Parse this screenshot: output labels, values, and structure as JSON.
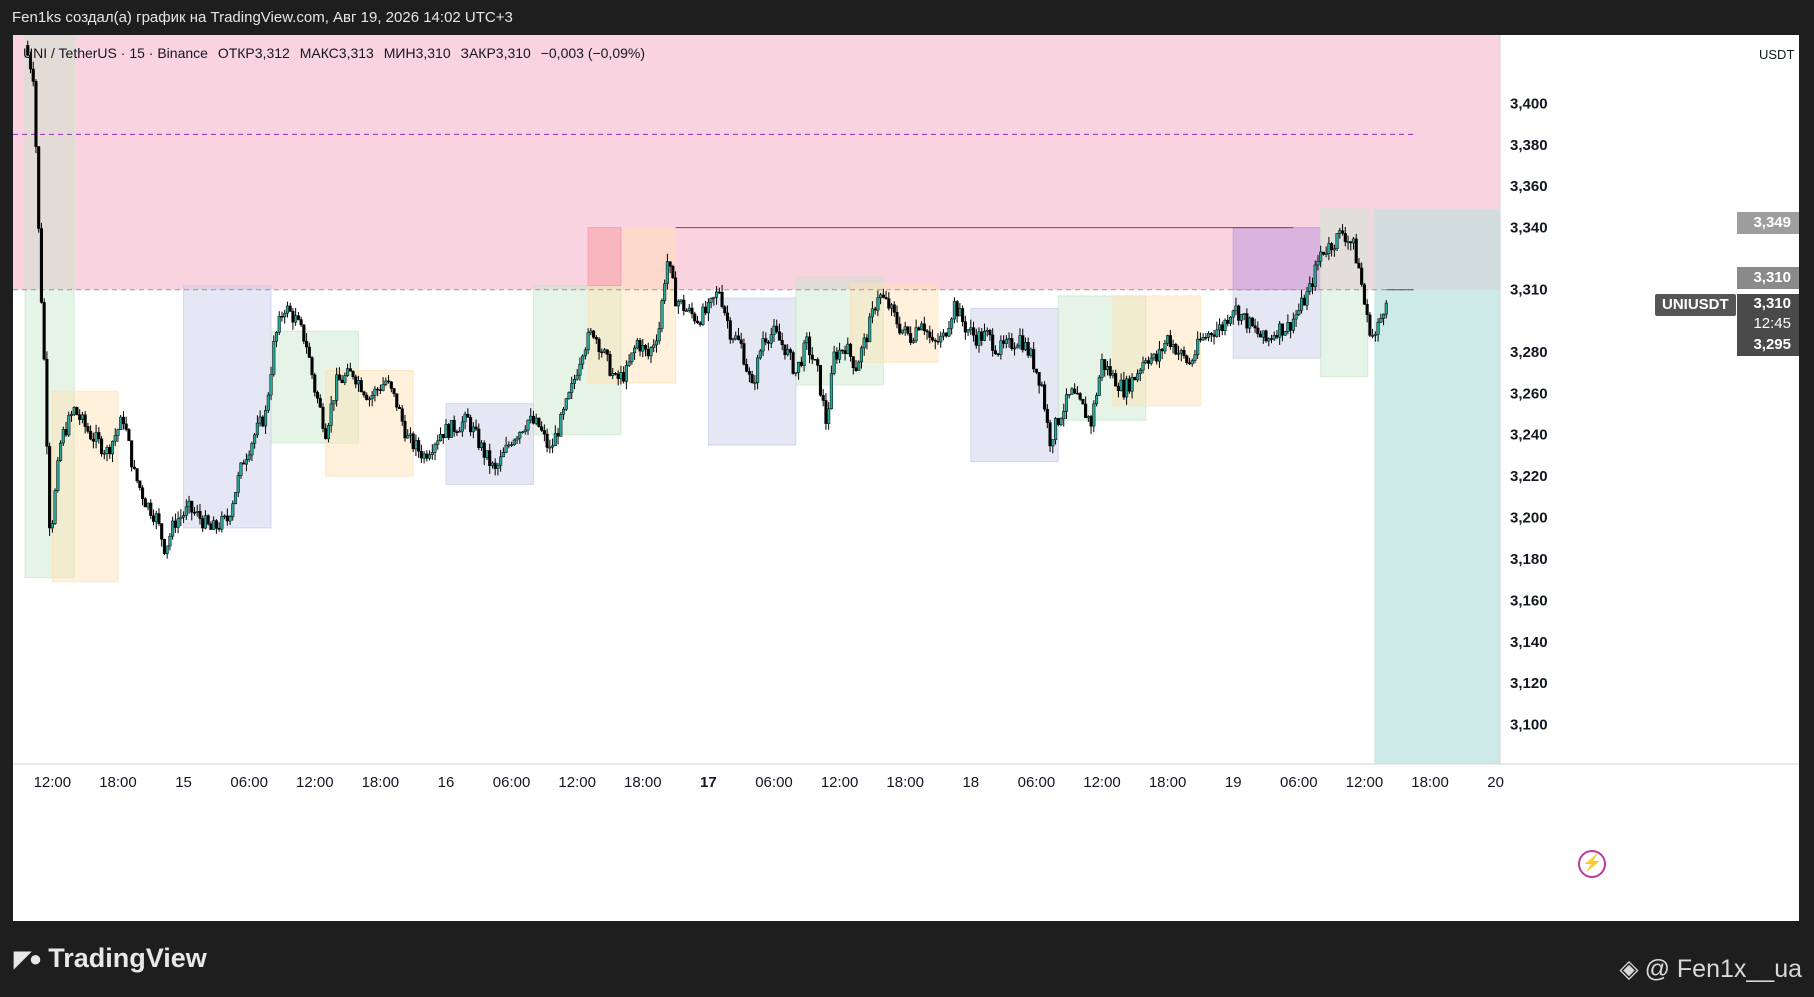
{
  "caption": "Fen1ks создал(а) график на TradingView.com, Авг 19, 2026 14:02 UTC+3",
  "ohlc": {
    "symbol": "UNI / TetherUS · 15 · Binance",
    "open": "ОТКР3,312",
    "high": "МАКС3,313",
    "low": "МИН3,310",
    "close": "ЗАКР3,310",
    "change": "−0,003 (−0,09%)"
  },
  "unit": "USDT",
  "badges": {
    "level_high": "3,349",
    "level_mid": "3,310",
    "current": "3,310",
    "countdown": "12:45",
    "level_low": "3,295",
    "symbol": "UNIUSDT"
  },
  "brand": "TradingView",
  "watermark": "@ Fen1x__ua",
  "colors": {
    "up": "#26a69a",
    "down": "#000000",
    "supply_zone": "#f8bbd0",
    "target_zone": "#b2dfdb",
    "blue_box": "#c5cae9",
    "green_box": "#c8e6c9",
    "orange_box": "#ffe0b2"
  },
  "icons": [
    "tradingview-logo-icon",
    "flash-icon",
    "binance-icon"
  ],
  "chart_data": {
    "type": "candlestick",
    "title": "",
    "y_ticks": [
      "3,400",
      "3,380",
      "3,360",
      "3,340",
      "3,310",
      "3,280",
      "3,260",
      "3,240",
      "3,220",
      "3,200",
      "3,180",
      "3,160",
      "3,140",
      "3,120",
      "3,100"
    ],
    "y_tick_values": [
      3.4,
      3.38,
      3.36,
      3.34,
      3.31,
      3.28,
      3.26,
      3.24,
      3.22,
      3.2,
      3.18,
      3.16,
      3.14,
      3.12,
      3.1
    ],
    "ylim": [
      3.081,
      3.433
    ],
    "x_ticks": [
      "12:00",
      "18:00",
      "15",
      "06:00",
      "12:00",
      "18:00",
      "16",
      "06:00",
      "12:00",
      "18:00",
      "17",
      "06:00",
      "12:00",
      "18:00",
      "18",
      "06:00",
      "12:00",
      "18:00",
      "19",
      "06:00",
      "12:00",
      "18:00",
      "20"
    ],
    "x_tick_hours": [
      12,
      18,
      24,
      30,
      36,
      42,
      48,
      54,
      60,
      66,
      72,
      78,
      84,
      90,
      96,
      102,
      108,
      114,
      120,
      126,
      132,
      138,
      144
    ],
    "bold_x_ticks": [
      "17"
    ],
    "xlim": [
      8.4,
      144.4
    ],
    "close_path": [
      [
        9.5,
        3.428
      ],
      [
        10.3,
        3.413
      ],
      [
        10.8,
        3.33
      ],
      [
        11.3,
        3.27
      ],
      [
        11.8,
        3.19
      ],
      [
        12.8,
        3.238
      ],
      [
        14,
        3.252
      ],
      [
        15.5,
        3.24
      ],
      [
        17,
        3.232
      ],
      [
        18.5,
        3.248
      ],
      [
        19.5,
        3.221
      ],
      [
        20.5,
        3.208
      ],
      [
        21.5,
        3.2
      ],
      [
        22.3,
        3.185
      ],
      [
        23.2,
        3.198
      ],
      [
        24.5,
        3.204
      ],
      [
        25.5,
        3.2
      ],
      [
        26.5,
        3.194
      ],
      [
        28,
        3.199
      ],
      [
        29.5,
        3.228
      ],
      [
        30.5,
        3.24
      ],
      [
        31.5,
        3.25
      ],
      [
        32.3,
        3.285
      ],
      [
        33.2,
        3.302
      ],
      [
        34.2,
        3.296
      ],
      [
        35.2,
        3.285
      ],
      [
        36,
        3.262
      ],
      [
        37,
        3.242
      ],
      [
        38,
        3.265
      ],
      [
        39.5,
        3.27
      ],
      [
        41,
        3.258
      ],
      [
        42.5,
        3.266
      ],
      [
        43.5,
        3.255
      ],
      [
        44.5,
        3.238
      ],
      [
        46,
        3.23
      ],
      [
        47.5,
        3.241
      ],
      [
        48.5,
        3.243
      ],
      [
        50,
        3.247
      ],
      [
        51.5,
        3.231
      ],
      [
        52.5,
        3.222
      ],
      [
        54,
        3.238
      ],
      [
        55.5,
        3.247
      ],
      [
        56.5,
        3.244
      ],
      [
        57.5,
        3.232
      ],
      [
        58.5,
        3.246
      ],
      [
        59.5,
        3.262
      ],
      [
        60.5,
        3.282
      ],
      [
        61.5,
        3.29
      ],
      [
        62.5,
        3.278
      ],
      [
        63.5,
        3.266
      ],
      [
        64.5,
        3.27
      ],
      [
        65.5,
        3.285
      ],
      [
        66.5,
        3.278
      ],
      [
        67.5,
        3.292
      ],
      [
        68.2,
        3.325
      ],
      [
        69,
        3.306
      ],
      [
        70,
        3.3
      ],
      [
        71,
        3.296
      ],
      [
        72,
        3.3
      ],
      [
        73,
        3.31
      ],
      [
        74,
        3.29
      ],
      [
        75,
        3.283
      ],
      [
        76,
        3.262
      ],
      [
        77,
        3.287
      ],
      [
        78,
        3.289
      ],
      [
        79,
        3.282
      ],
      [
        80,
        3.27
      ],
      [
        81,
        3.284
      ],
      [
        82,
        3.27
      ],
      [
        82.8,
        3.245
      ],
      [
        83.5,
        3.278
      ],
      [
        84.5,
        3.283
      ],
      [
        85.5,
        3.273
      ],
      [
        86.5,
        3.288
      ],
      [
        87.5,
        3.308
      ],
      [
        88.5,
        3.302
      ],
      [
        89.5,
        3.292
      ],
      [
        90.5,
        3.287
      ],
      [
        91.5,
        3.296
      ],
      [
        92.5,
        3.283
      ],
      [
        93.5,
        3.287
      ],
      [
        94.5,
        3.303
      ],
      [
        95.5,
        3.292
      ],
      [
        96.5,
        3.287
      ],
      [
        97.5,
        3.288
      ],
      [
        98.5,
        3.281
      ],
      [
        99.5,
        3.283
      ],
      [
        100.5,
        3.287
      ],
      [
        101.5,
        3.278
      ],
      [
        102.5,
        3.264
      ],
      [
        103.2,
        3.237
      ],
      [
        104.2,
        3.25
      ],
      [
        105.2,
        3.26
      ],
      [
        106.2,
        3.253
      ],
      [
        107,
        3.246
      ],
      [
        108,
        3.275
      ],
      [
        109,
        3.268
      ],
      [
        110,
        3.262
      ],
      [
        111,
        3.268
      ],
      [
        112,
        3.278
      ],
      [
        113,
        3.276
      ],
      [
        114,
        3.287
      ],
      [
        115,
        3.28
      ],
      [
        116,
        3.274
      ],
      [
        117,
        3.285
      ],
      [
        118,
        3.29
      ],
      [
        119,
        3.292
      ],
      [
        120,
        3.302
      ],
      [
        121,
        3.296
      ],
      [
        122,
        3.29
      ],
      [
        123,
        3.285
      ],
      [
        124,
        3.291
      ],
      [
        125,
        3.292
      ],
      [
        126,
        3.3
      ],
      [
        127,
        3.31
      ],
      [
        128,
        3.328
      ],
      [
        129,
        3.332
      ],
      [
        130,
        3.338
      ],
      [
        131,
        3.331
      ],
      [
        131.6,
        3.318
      ],
      [
        132.2,
        3.296
      ],
      [
        132.9,
        3.286
      ],
      [
        133.6,
        3.298
      ],
      [
        134.2,
        3.312
      ]
    ],
    "zones": [
      {
        "name": "supply-zone",
        "x": [
          8.4,
          144.4
        ],
        "y": [
          3.31,
          3.433
        ],
        "color": "#f8bbd0"
      },
      {
        "name": "target-zone",
        "x": [
          132.9,
          144.4
        ],
        "y": [
          3.081,
          3.349
        ],
        "color": "#b2dfdb"
      }
    ],
    "boxes": [
      {
        "x": [
          9.5,
          14
        ],
        "y": [
          3.171,
          3.435
        ],
        "color": "#c8e6c9"
      },
      {
        "x": [
          12,
          18
        ],
        "y": [
          3.169,
          3.261
        ],
        "color": "#ffe0b2"
      },
      {
        "x": [
          24,
          32
        ],
        "y": [
          3.195,
          3.312
        ],
        "color": "#c5cae9"
      },
      {
        "x": [
          32,
          40
        ],
        "y": [
          3.236,
          3.29
        ],
        "color": "#c8e6c9"
      },
      {
        "x": [
          37,
          45
        ],
        "y": [
          3.22,
          3.271
        ],
        "color": "#ffe0b2"
      },
      {
        "x": [
          48,
          56
        ],
        "y": [
          3.216,
          3.255
        ],
        "color": "#c5cae9"
      },
      {
        "x": [
          56,
          64
        ],
        "y": [
          3.24,
          3.312
        ],
        "color": "#c8e6c9"
      },
      {
        "x": [
          61,
          69
        ],
        "y": [
          3.265,
          3.34
        ],
        "color": "#ffe0b2"
      },
      {
        "x": [
          61,
          64
        ],
        "y": [
          3.312,
          3.34
        ],
        "color": "#f48fb1"
      },
      {
        "x": [
          72,
          80
        ],
        "y": [
          3.235,
          3.306
        ],
        "color": "#c5cae9"
      },
      {
        "x": [
          80,
          88
        ],
        "y": [
          3.264,
          3.316
        ],
        "color": "#c8e6c9"
      },
      {
        "x": [
          85,
          93
        ],
        "y": [
          3.275,
          3.313
        ],
        "color": "#ffe0b2"
      },
      {
        "x": [
          96,
          104
        ],
        "y": [
          3.227,
          3.301
        ],
        "color": "#c5cae9"
      },
      {
        "x": [
          104,
          112
        ],
        "y": [
          3.247,
          3.307
        ],
        "color": "#c8e6c9"
      },
      {
        "x": [
          109,
          117
        ],
        "y": [
          3.254,
          3.307
        ],
        "color": "#ffe0b2"
      },
      {
        "x": [
          120,
          128
        ],
        "y": [
          3.277,
          3.34
        ],
        "color": "#c5cae9"
      },
      {
        "x": [
          120,
          128
        ],
        "y": [
          3.31,
          3.34
        ],
        "color": "#ce93d8"
      },
      {
        "x": [
          128,
          132.3
        ],
        "y": [
          3.268,
          3.349
        ],
        "color": "#c8e6c9"
      },
      {
        "x": [
          128,
          144.4
        ],
        "y": [
          3.31,
          3.349
        ],
        "color": "#e0e0e0"
      }
    ],
    "horizontal_lines": [
      {
        "name": "dashed-level",
        "y": 3.385,
        "x": [
          8.4,
          136.5
        ],
        "color": "#9c27b0",
        "dashed": true
      },
      {
        "name": "high-level",
        "y": 3.34,
        "x": [
          69,
          125.5
        ],
        "color": "#7a4a4a",
        "dashed": false
      },
      {
        "name": "current-price-line",
        "y": 3.31,
        "x": [
          8.4,
          136.5
        ],
        "color": "#999999",
        "dashed": true
      },
      {
        "name": "target-line",
        "y": 3.31,
        "x": [
          134,
          136.5
        ],
        "color": "#555555",
        "dashed": false
      }
    ]
  }
}
